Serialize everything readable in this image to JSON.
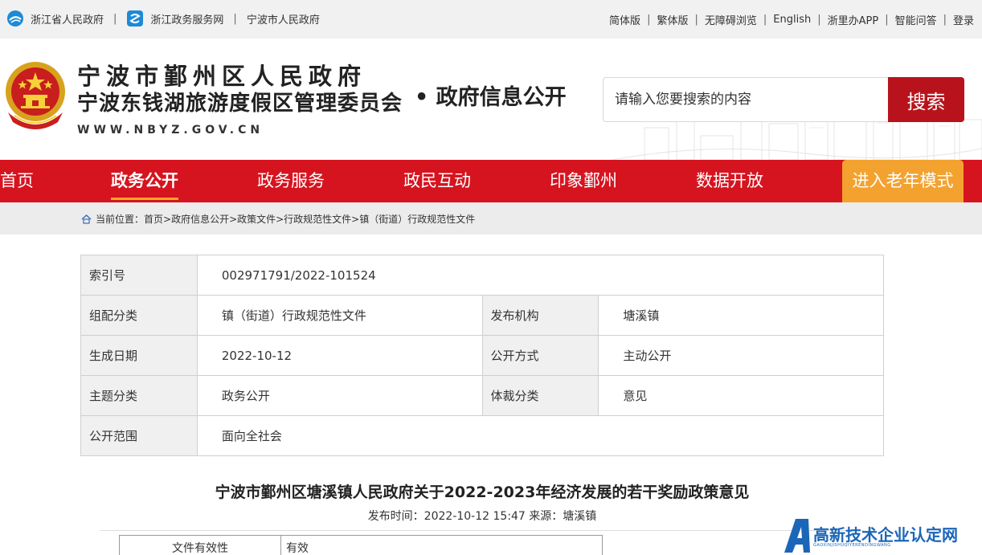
{
  "topbar": {
    "left": [
      {
        "label": "浙江省人民政府",
        "icon": "zhejiang-gov-icon"
      },
      {
        "label": "浙江政务服务网",
        "icon": "zhejiang-service-icon"
      },
      {
        "label": "宁波市人民政府"
      }
    ],
    "right": [
      "简体版",
      "繁体版",
      "无障碍浏览",
      "English",
      "浙里办APP",
      "智能问答",
      "登录"
    ]
  },
  "header": {
    "title_line1": "宁波市鄞州区人民政府",
    "title_line2": "宁波东钱湖旅游度假区管理委员会",
    "domain": "WWW.NBYZ.GOV.CN",
    "section": "• 政府信息公开",
    "search_placeholder": "请输入您要搜索的内容",
    "search_button": "搜索"
  },
  "nav": {
    "items": [
      "首页",
      "政务公开",
      "政务服务",
      "政民互动",
      "印象鄞州",
      "数据开放"
    ],
    "active_index": 1,
    "elder_mode": "进入老年模式"
  },
  "breadcrumb": {
    "prefix": "当前位置：",
    "path": "首页>政府信息公开>政策文件>行政规范性文件>镇（街道）行政规范性文件"
  },
  "info_table": {
    "index_label": "索引号",
    "index_value": "002971791/2022-101524",
    "category_label": "组配分类",
    "category_value": "镇（街道）行政规范性文件",
    "publisher_label": "发布机构",
    "publisher_value": "塘溪镇",
    "date_label": "生成日期",
    "date_value": "2022-10-12",
    "method_label": "公开方式",
    "method_value": "主动公开",
    "topic_label": "主题分类",
    "topic_value": "政务公开",
    "genre_label": "体裁分类",
    "genre_value": "意见",
    "scope_label": "公开范围",
    "scope_value": "面向全社会"
  },
  "article": {
    "title": "宁波市鄞州区塘溪镇人民政府关于2022-2023年经济发展的若干奖励政策意见",
    "meta": "发布时间：2022-10-12 15:47 来源：塘溪镇",
    "validity_label": "文件有效性",
    "validity_value": "有效"
  },
  "watermark": {
    "text": "高新技术企业认定网",
    "sub": "GAOXINJISHUQIYERENDINGWANG"
  },
  "colors": {
    "nav_red": "#d6141f",
    "search_red": "#b8131c",
    "elder_orange": "#f3a22f",
    "watermark_blue": "#1b66b8"
  }
}
